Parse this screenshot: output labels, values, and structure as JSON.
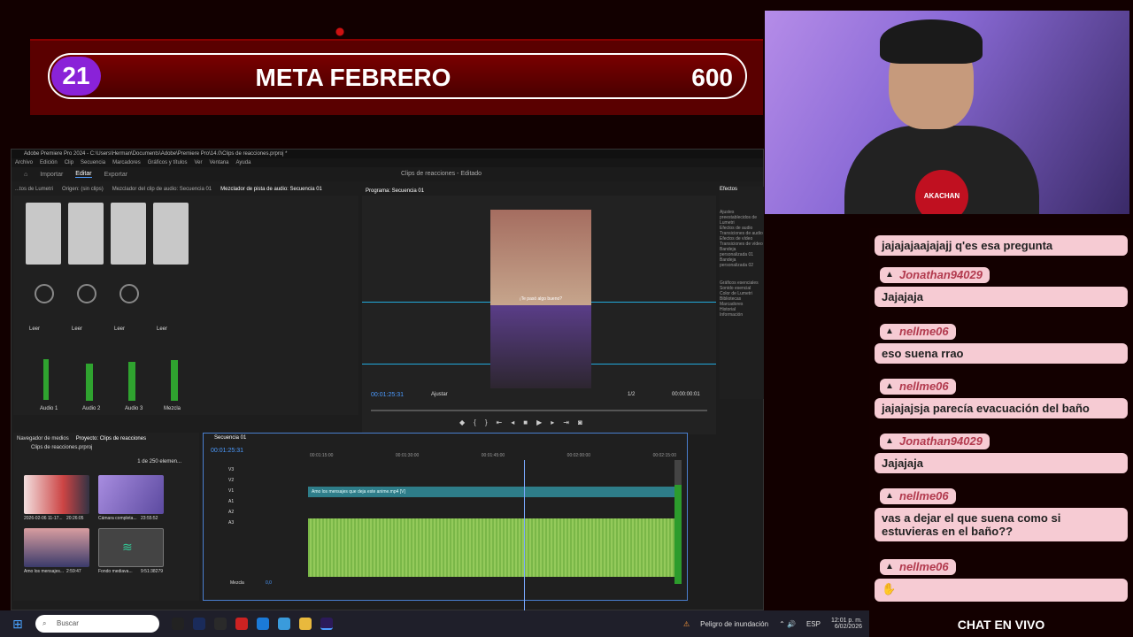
{
  "goal": {
    "count": "21",
    "title": "META FEBRERO",
    "target": "600"
  },
  "premiere": {
    "titlebar": "Adobe Premiere Pro 2024 - C:\\Users\\Herman\\Documents\\Adobe\\Premiere Pro\\14.0\\Clips de reacciones.prproj *",
    "menus": [
      "Archivo",
      "Edición",
      "Clip",
      "Secuencia",
      "Marcadores",
      "Gráficos y títulos",
      "Ver",
      "Ventana",
      "Ayuda"
    ],
    "workspace_tabs": [
      "Importar",
      "Editar",
      "Exportar"
    ],
    "active_workspace": "Editar",
    "doc_title": "Clips de reacciones",
    "doc_status": "Editado",
    "left_tabs": [
      "...tos de Lumetri",
      "Origen: (sin clips)",
      "Mezclador del clip de audio: Secuencia 01",
      "Mezclador de pista de audio: Secuencia 01"
    ],
    "mixer_channels": [
      "Audio 1",
      "Audio 2",
      "Audio 3",
      "Mezcla"
    ],
    "mixer_mode": "Leer",
    "program_tab": "Programa: Secuencia 01",
    "program_timecode": "00:01:25:31",
    "program_fit": "Ajustar",
    "program_ratio": "1/2",
    "program_end": "00:00:00:01",
    "video_caption": "¡Te pasó algo bueno?",
    "effects_title": "Efectos",
    "effects_items": [
      "Ajustes preestablecidos de Lumetri",
      "Efectos de audio",
      "Transiciones de audio",
      "Efectos de vídeo",
      "Transiciones de vídeo",
      "Bandeja personalizada 01",
      "Bandeja personalizada 02"
    ],
    "side_panels": [
      "Gráficos esenciales",
      "Sonido esencial",
      "Color de Lumetri",
      "Bibliotecas",
      "Marcadores",
      "Historial",
      "Información"
    ],
    "project_tab": "Proyecto: Clips de reacciones",
    "media_tab": "Navegador de medios",
    "project_file": "Clips de reacciones.prproj",
    "project_count": "1 de 250 elemen...",
    "thumbs": [
      {
        "label": "2026-02-06 11-17...",
        "duration": "20:26:05"
      },
      {
        "label": "Cámara completa...",
        "duration": "23:55:52"
      },
      {
        "label": "Amo los mensajes...",
        "duration": "2:59:47"
      },
      {
        "label": "Fondo mediava...",
        "duration": "9:51:38279"
      }
    ],
    "sequence_tab": "Secuencia 01",
    "sequence_timecode": "00:01:25:31",
    "ruler_marks": [
      "00:01:15:00",
      "00:01:30:00",
      "00:01:45:00",
      "00:02:00:00",
      "00:02:15:00"
    ],
    "video_clip_label": "Amo los mensajes que deja este anime.mp4 [V]",
    "tracks": [
      "V3",
      "V2",
      "V1",
      "A1",
      "A2",
      "A3"
    ],
    "mix_label": "Mezcla",
    "mix_value": "0,0"
  },
  "webcam": {
    "badge": "AKACHAN"
  },
  "chat": {
    "messages": [
      {
        "type": "text",
        "text": "jajajajaajajajj q'es esa pregunta"
      },
      {
        "type": "user",
        "name": "Jonathan94029"
      },
      {
        "type": "text",
        "text": "Jajajaja"
      },
      {
        "type": "user",
        "name": "nellme06"
      },
      {
        "type": "text",
        "text": "eso suena rrao"
      },
      {
        "type": "user",
        "name": "nellme06"
      },
      {
        "type": "text",
        "text": "jajajajsja parecía evacuación del baño"
      },
      {
        "type": "user",
        "name": "Jonathan94029"
      },
      {
        "type": "text",
        "text": "Jajajaja"
      },
      {
        "type": "user",
        "name": "nellme06"
      },
      {
        "type": "text",
        "text": "vas a dejar el que suena como si estuvieras en el baño??"
      },
      {
        "type": "user",
        "name": "nellme06"
      }
    ],
    "footer": "CHAT EN VIVO"
  },
  "taskbar": {
    "search_placeholder": "Buscar",
    "weather": "Peligro de inundación",
    "lang": "ESP",
    "time": "12:01 p. m.",
    "date": "6/02/2026"
  }
}
